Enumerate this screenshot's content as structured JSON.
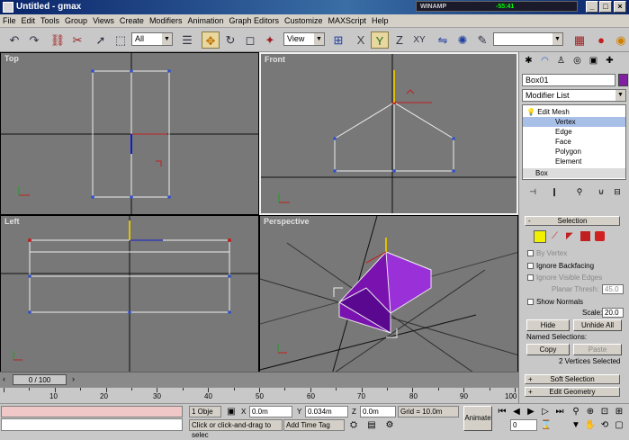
{
  "window": {
    "title": "Untitled - gmax",
    "minimize": "_",
    "maximize": "□",
    "close": "×"
  },
  "winamp": {
    "label": "WINAMP",
    "readout": "-55:41"
  },
  "menu": [
    "File",
    "Edit",
    "Tools",
    "Group",
    "Views",
    "Create",
    "Modifiers",
    "Animation",
    "Graph Editors",
    "Customize",
    "MAXScript",
    "Help"
  ],
  "toolbar": {
    "filter": "All",
    "coord": "View",
    "named_sel": ""
  },
  "viewports": {
    "top": "Top",
    "front": "Front",
    "left": "Left",
    "perspective": "Perspective"
  },
  "panel": {
    "object_name": "Box01",
    "object_color": "#8020a0",
    "modifier_list": "Modifier List",
    "stack": [
      {
        "label": "Edit Mesh",
        "level": 0
      },
      {
        "label": "Vertex",
        "level": 1
      },
      {
        "label": "Edge",
        "level": 1
      },
      {
        "label": "Face",
        "level": 1
      },
      {
        "label": "Polygon",
        "level": 1
      },
      {
        "label": "Element",
        "level": 1
      },
      {
        "label": "Box",
        "level": 0
      }
    ],
    "selection": {
      "title": "Selection",
      "by_vertex": "By Vertex",
      "ignore_backfacing": "Ignore Backfacing",
      "ignore_visible_edges": "Ignore Visible Edges",
      "planar_thresh_label": "Planar Thresh:",
      "planar_thresh": "45.0",
      "show_normals": "Show Normals",
      "scale_label": "Scale:",
      "scale": "20.0",
      "hide": "Hide",
      "unhide_all": "Unhide All",
      "named_selections": "Named Selections:",
      "copy": "Copy",
      "paste": "Paste",
      "status": "2 Vertices Selected"
    },
    "soft_selection": "Soft Selection",
    "edit_geometry": "Edit Geometry"
  },
  "timeline": {
    "slider": "0 / 100",
    "ticks": [
      "10",
      "20",
      "30",
      "40",
      "50",
      "60",
      "70",
      "80",
      "90",
      "100"
    ]
  },
  "status": {
    "objects": "1 Obje",
    "x_label": "X",
    "x": "0.0m",
    "y_label": "Y",
    "y": "0.034m",
    "z_label": "Z",
    "z": "0.0m",
    "grid": "Grid = 10.0m",
    "prompt": "Click or click-and-drag to selec",
    "add_time_tag": "Add Time Tag",
    "animate": "Animate",
    "frame": "0"
  }
}
